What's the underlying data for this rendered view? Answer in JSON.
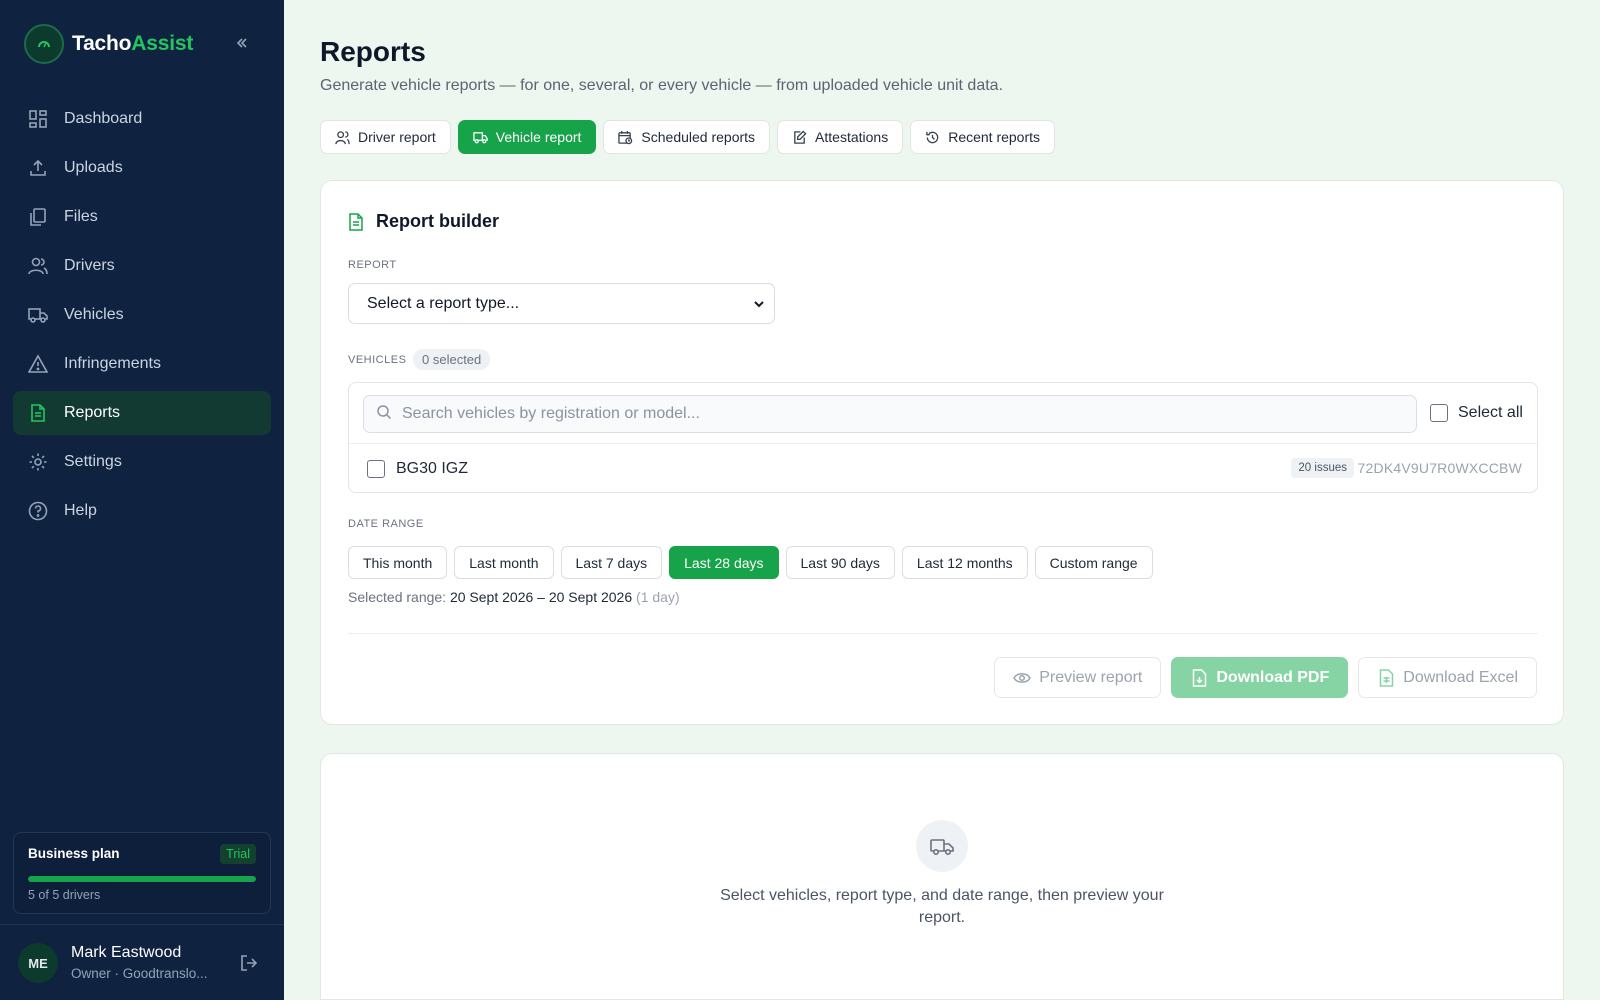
{
  "brand": {
    "name_part1": "Tacho",
    "name_part2": "Assist"
  },
  "sidebar": {
    "items": [
      {
        "label": "Dashboard",
        "icon": "grid-icon"
      },
      {
        "label": "Uploads",
        "icon": "upload-icon"
      },
      {
        "label": "Files",
        "icon": "files-icon"
      },
      {
        "label": "Drivers",
        "icon": "users-icon"
      },
      {
        "label": "Vehicles",
        "icon": "truck-icon"
      },
      {
        "label": "Infringements",
        "icon": "warning-icon"
      },
      {
        "label": "Reports",
        "icon": "document-icon",
        "active": true
      },
      {
        "label": "Settings",
        "icon": "gear-icon"
      },
      {
        "label": "Help",
        "icon": "help-icon"
      }
    ],
    "plan": {
      "title": "Business plan",
      "badge": "Trial",
      "usage": "5 of 5 drivers",
      "used": 5,
      "total": 5
    },
    "user": {
      "initials": "ME",
      "name": "Mark Eastwood",
      "role": "Owner · Goodtranslo..."
    }
  },
  "header": {
    "title": "Reports",
    "subtitle": "Generate vehicle reports — for one, several, or every vehicle — from uploaded vehicle unit data."
  },
  "tabs": [
    {
      "label": "Driver report",
      "icon": "user-icon"
    },
    {
      "label": "Vehicle report",
      "icon": "truck-icon",
      "active": true
    },
    {
      "label": "Scheduled reports",
      "icon": "calendar-clock-icon"
    },
    {
      "label": "Attestations",
      "icon": "edit-icon"
    },
    {
      "label": "Recent reports",
      "icon": "history-icon"
    }
  ],
  "builder": {
    "title": "Report builder",
    "report_label": "REPORT",
    "report_select_value": "Select a report type...",
    "vehicles_label": "VEHICLES",
    "selected_count": "0 selected",
    "search_placeholder": "Search vehicles by registration or model...",
    "select_all_label": "Select all",
    "vehicles": [
      {
        "reg": "BG30 IGZ",
        "issues": "20 issues",
        "vin": "72DK4V9U7R0WXCCBW"
      }
    ],
    "date_range_label": "DATE RANGE",
    "ranges": [
      {
        "label": "This month"
      },
      {
        "label": "Last month"
      },
      {
        "label": "Last 7 days"
      },
      {
        "label": "Last 28 days",
        "active": true
      },
      {
        "label": "Last 90 days"
      },
      {
        "label": "Last 12 months"
      },
      {
        "label": "Custom range"
      }
    ],
    "selected_range_prefix": "Selected range:",
    "selected_range_value": "20 Sept 2026 – 20 Sept 2026",
    "selected_range_days": "(1 day)",
    "actions": {
      "preview": "Preview report",
      "pdf": "Download PDF",
      "excel": "Download Excel"
    }
  },
  "empty_state": {
    "text": "Select vehicles, report type, and date range, then preview your report."
  },
  "colors": {
    "accent": "#16a34a",
    "sidebar_bg": "#0f2240",
    "page_bg": "#edf7ef"
  }
}
